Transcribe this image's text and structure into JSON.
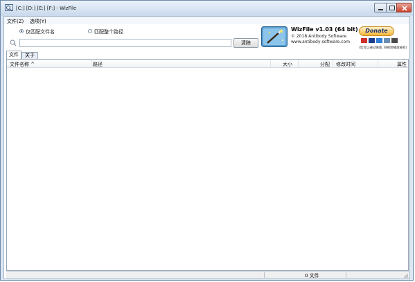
{
  "window": {
    "title": "[C:] [D:] [E:] [F:]  - WizFile"
  },
  "menu": {
    "file": "文件(Z)",
    "options": "选项(Y)"
  },
  "search": {
    "radio_filename": "仅匹配文件名",
    "radio_fullpath": "匹配整个路径",
    "selected": "filename",
    "value": "",
    "clear_label": "清除"
  },
  "about_panel": {
    "app_name": "WizFile v1.03 (64 bit)",
    "copyright": "© 2018 Antibody Software",
    "url": "www.antibody-software.com",
    "donate_label": "Donate",
    "donate_note": "(您可以通过维基, 除视频播放被权)"
  },
  "tabs": [
    {
      "label": "文件",
      "active": true
    },
    {
      "label": "关于",
      "active": false
    }
  ],
  "columns": {
    "name": "文件名称 ^",
    "path": "路径",
    "size": "大小",
    "allocated": "分配",
    "modified": "修改时间",
    "attributes": "属性"
  },
  "status": {
    "count": "0 文件"
  },
  "colors": {
    "frame": "#dce7f3",
    "accent": "#1e3f72",
    "donate": "#f7b738"
  }
}
